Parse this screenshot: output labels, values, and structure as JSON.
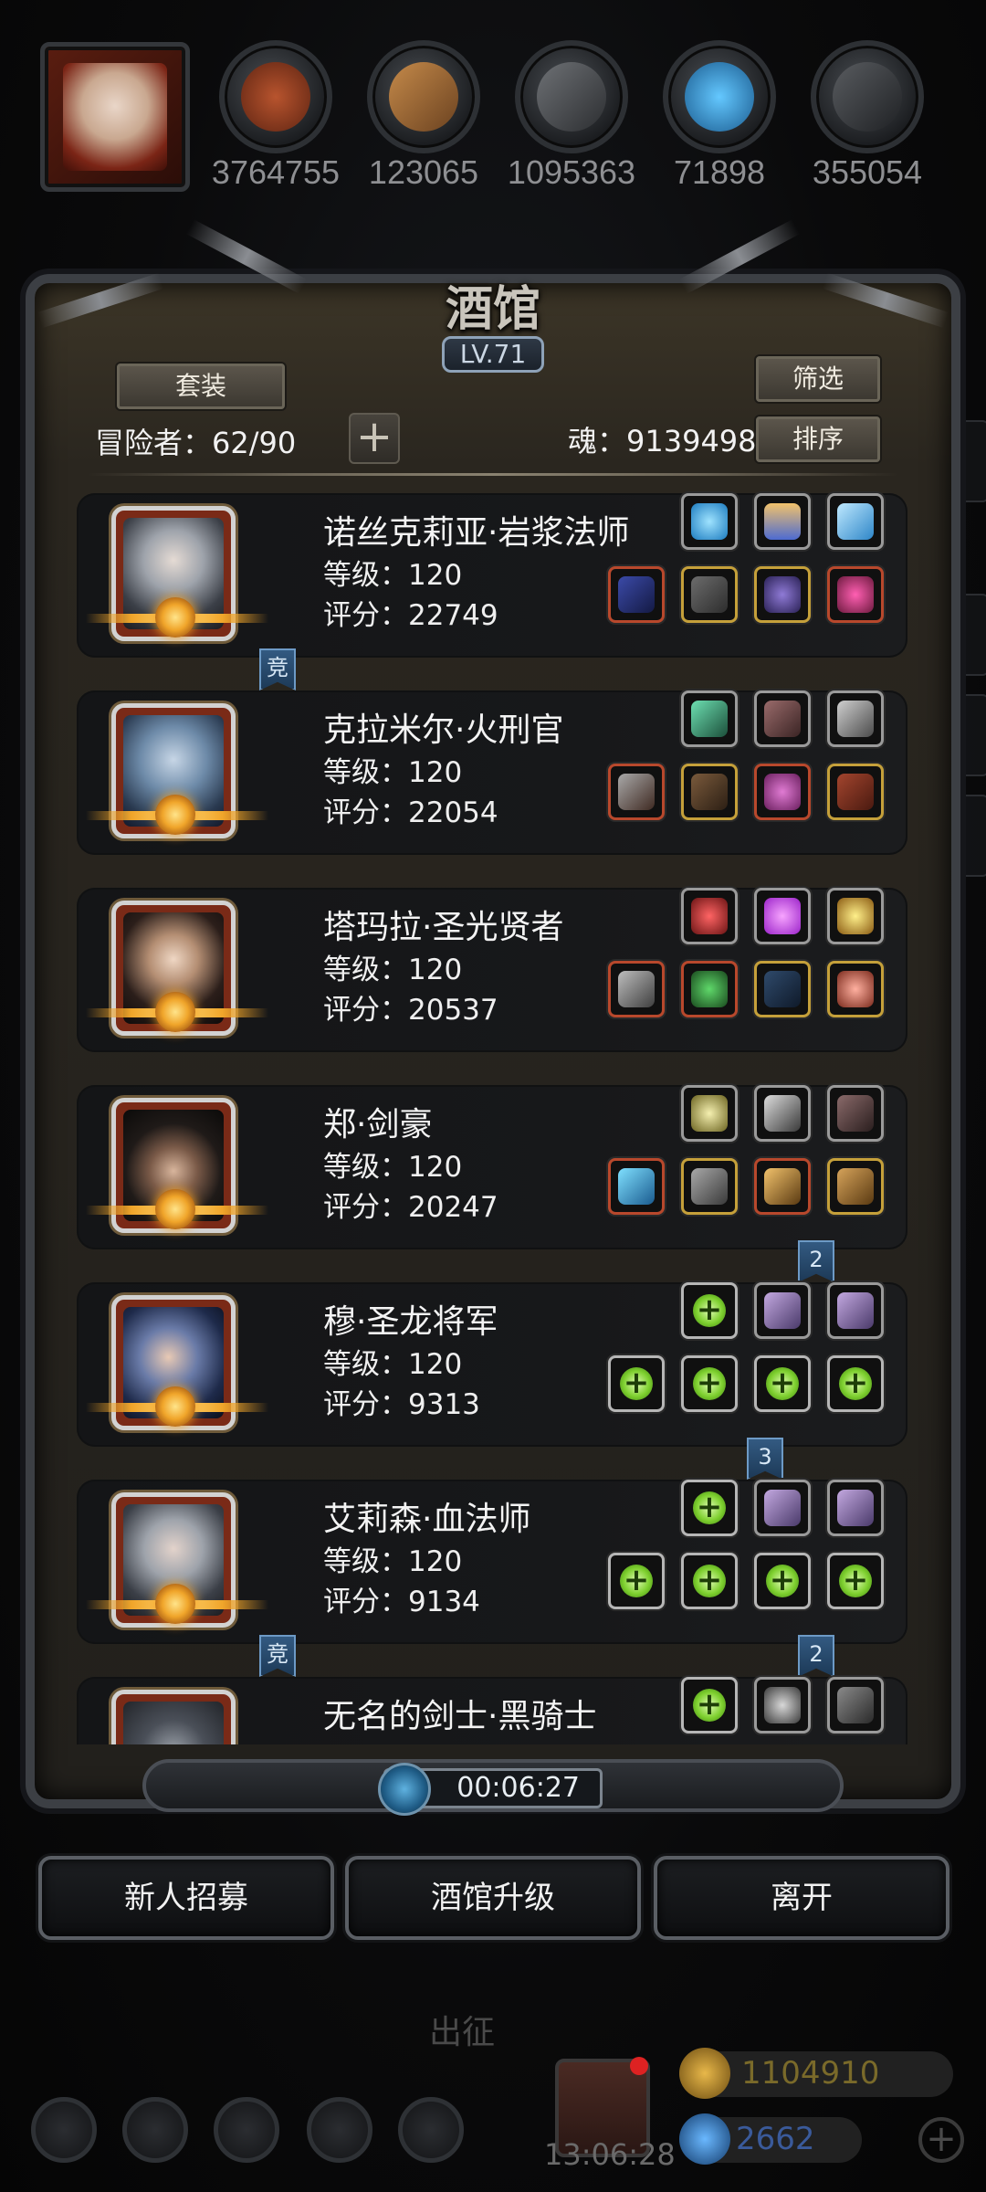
{
  "resources": [
    {
      "icon": "meat-icon",
      "value": "3764755"
    },
    {
      "icon": "wood-icon",
      "value": "123065"
    },
    {
      "icon": "iron-icon",
      "value": "1095363"
    },
    {
      "icon": "crystal-icon",
      "value": "71898"
    },
    {
      "icon": "ore-icon",
      "value": "355054"
    }
  ],
  "panel": {
    "title": "酒馆",
    "level": "LV.71",
    "set_button": "套装",
    "filter_button": "筛选",
    "sort_button": "排序",
    "adventurers": "冒险者：62/90",
    "soul": "魂：9139498"
  },
  "heroes": [
    {
      "name": "诺丝克莉亚·岩浆法师",
      "level": "等级：120",
      "score": "评分：22749"
    },
    {
      "name": "克拉米尔·火刑官",
      "level": "等级：120",
      "score": "评分：22054"
    },
    {
      "name": "塔玛拉·圣光贤者",
      "level": "等级：120",
      "score": "评分：20537"
    },
    {
      "name": "郑·剑豪",
      "level": "等级：120",
      "score": "评分：20247"
    },
    {
      "name": "穆·圣龙将军",
      "level": "等级：120",
      "score": "评分：9313"
    },
    {
      "name": "艾莉森·血法师",
      "level": "等级：120",
      "score": "评分：9134"
    },
    {
      "name": "无名的剑士·黑骑士",
      "level": "",
      "score": ""
    }
  ],
  "tags": {
    "compete": "竞",
    "two": "2",
    "three": "3"
  },
  "timer": "00:06:27",
  "buttons": {
    "recruit": "新人招募",
    "upgrade": "酒馆升级",
    "leave": "离开"
  },
  "footer": {
    "expedition": "出征",
    "clock": "13:06:28",
    "gold": "1104910",
    "gems": "2662"
  },
  "colors": {
    "accent_gold": "#f0a52a",
    "add_green": "#7ed02f",
    "panel_border": "#3c3f44"
  }
}
